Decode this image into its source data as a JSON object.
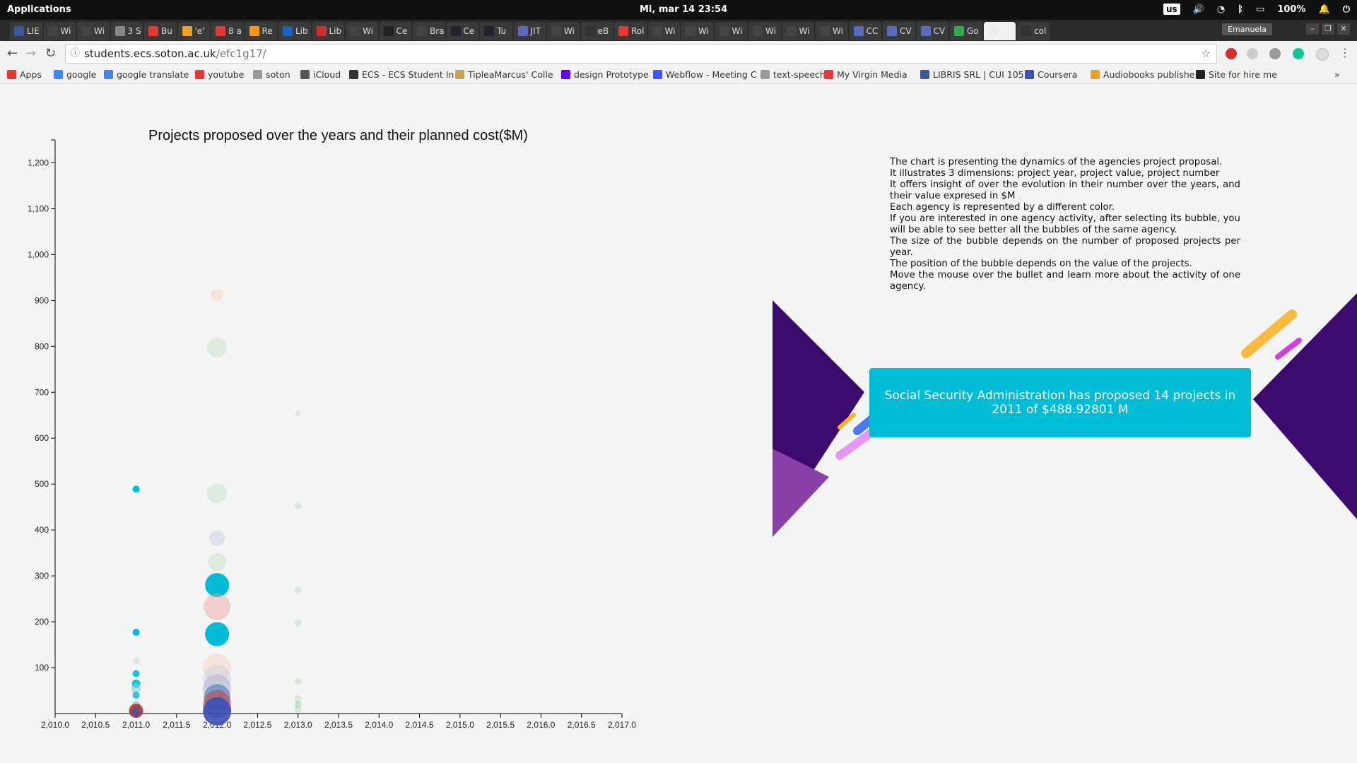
{
  "system_bar": {
    "apps_label": "Applications",
    "datetime": "Mi, mar 14    23:54",
    "keyboard": "us",
    "battery": "100%"
  },
  "browser": {
    "tabs": [
      "LIE",
      "Wi",
      "Wi",
      "3 S",
      "Bu",
      "'e'",
      "8 a",
      "Re",
      "Lib",
      "Lib",
      "Wi",
      "Ce",
      "Bra",
      "Ce",
      "Tu",
      "JIT",
      "Wi",
      "eB",
      "Rol",
      "Wi",
      "Wi",
      "Wi",
      "Wi",
      "Wi",
      "Wi",
      "CC",
      "CV",
      "CV",
      "Go",
      "",
      "col"
    ],
    "user": "Emanuela",
    "url_host": "students.ecs.soton.ac.uk",
    "url_path": "/efc1g17/",
    "bookmarks": [
      "Apps",
      "google",
      "google translate",
      "youtube",
      "soton",
      "iCloud",
      "ECS - ECS Student In",
      "TipleaMarcus' Colle",
      "design Prototype",
      "Webflow - Meeting C",
      "text-speech",
      "My Virgin Media",
      "LIBRIS SRL | CUI 105",
      "Coursera",
      "Audiobooks publishe",
      "Site for hire me"
    ]
  },
  "description": [
    "The chart is presenting the dynamics of the agencies project proposal.",
    "It illustrates 3 dimensions: project year, project value, project number",
    "It offers insight of over the evolution in their number over the years, and their value expresed in $M",
    "Each agency is represented by a different color.",
    "If you are interested in one agency activity, after selecting its bubble, you will be able to see better all the bubbles of the same agency.",
    "The size of the bubble depends on the number of proposed projects per year.",
    "The position of the bubble depends on the value of the projects.",
    "Move the mouse over the bullet and learn more about the activity of one agency."
  ],
  "tooltip": "Social Security Administration has proposed 14 projects in 2011 of $488.92801 M",
  "chart_data": {
    "type": "scatter",
    "title": "Projects proposed over the years and their planned cost($M)",
    "xlabel": "",
    "ylabel": "",
    "xlim": [
      2010.0,
      2017.0
    ],
    "ylim": [
      0,
      1250
    ],
    "x_ticks": [
      "2,010.0",
      "2,010.5",
      "2,011.0",
      "2,011.5",
      "2,012.0",
      "2,012.5",
      "2,013.0",
      "2,013.5",
      "2,014.0",
      "2,014.5",
      "2,015.0",
      "2,015.5",
      "2,016.0",
      "2,016.5",
      "2,017.0"
    ],
    "y_ticks": [
      "100",
      "200",
      "300",
      "400",
      "500",
      "600",
      "700",
      "800",
      "900",
      "1,000",
      "1,100",
      "1,200"
    ],
    "points": [
      {
        "x": 2011,
        "y": 489,
        "size": 5,
        "color": "#00bcd4",
        "opacity": 1
      },
      {
        "x": 2011,
        "y": 177,
        "size": 5,
        "color": "#00bcd4",
        "opacity": 1
      },
      {
        "x": 2011,
        "y": 115,
        "size": 5,
        "color": "#c8c8c8",
        "opacity": 0.4
      },
      {
        "x": 2011,
        "y": 87,
        "size": 5,
        "color": "#00bcd4",
        "opacity": 0.9
      },
      {
        "x": 2011,
        "y": 65,
        "size": 6,
        "color": "#00bcd4",
        "opacity": 0.9
      },
      {
        "x": 2011,
        "y": 55,
        "size": 7,
        "color": "#7fcfdc",
        "opacity": 0.6
      },
      {
        "x": 2011,
        "y": 40,
        "size": 5,
        "color": "#00bcd4",
        "opacity": 0.8
      },
      {
        "x": 2011,
        "y": 18,
        "size": 6,
        "color": "#9aa6c8",
        "opacity": 0.6
      },
      {
        "x": 2011,
        "y": 6,
        "size": 10,
        "color": "#b0302e",
        "opacity": 0.9
      },
      {
        "x": 2011,
        "y": 3,
        "size": 6,
        "color": "#3a55b0",
        "opacity": 0.8
      },
      {
        "x": 2012,
        "y": 912,
        "size": 9,
        "color": "#f5c8a8",
        "opacity": 0.35
      },
      {
        "x": 2012,
        "y": 797,
        "size": 14,
        "color": "#9ed4a8",
        "opacity": 0.3
      },
      {
        "x": 2012,
        "y": 480,
        "size": 14,
        "color": "#9ed4a8",
        "opacity": 0.3
      },
      {
        "x": 2012,
        "y": 382,
        "size": 11,
        "color": "#aab4dc",
        "opacity": 0.3
      },
      {
        "x": 2012,
        "y": 330,
        "size": 13,
        "color": "#9ed4a8",
        "opacity": 0.3
      },
      {
        "x": 2012,
        "y": 280,
        "size": 17,
        "color": "#00bcd4",
        "opacity": 1
      },
      {
        "x": 2012,
        "y": 233,
        "size": 19,
        "color": "#f0a0a0",
        "opacity": 0.45
      },
      {
        "x": 2012,
        "y": 173,
        "size": 17,
        "color": "#00bcd4",
        "opacity": 1
      },
      {
        "x": 2012,
        "y": 100,
        "size": 20,
        "color": "#f0c8b0",
        "opacity": 0.35
      },
      {
        "x": 2012,
        "y": 75,
        "size": 20,
        "color": "#c8c8e0",
        "opacity": 0.4
      },
      {
        "x": 2012,
        "y": 55,
        "size": 20,
        "color": "#a8a8d0",
        "opacity": 0.45
      },
      {
        "x": 2012,
        "y": 35,
        "size": 19,
        "color": "#4a7ab0",
        "opacity": 0.6
      },
      {
        "x": 2012,
        "y": 20,
        "size": 20,
        "color": "#c04040",
        "opacity": 0.55
      },
      {
        "x": 2012,
        "y": 5,
        "size": 20,
        "color": "#3a50b8",
        "opacity": 0.9
      },
      {
        "x": 2013,
        "y": 654,
        "size": 4,
        "color": "#9ed4a8",
        "opacity": 0.35
      },
      {
        "x": 2013,
        "y": 452,
        "size": 5,
        "color": "#9ed4a8",
        "opacity": 0.35
      },
      {
        "x": 2013,
        "y": 270,
        "size": 5,
        "color": "#9ed4a8",
        "opacity": 0.35
      },
      {
        "x": 2013,
        "y": 198,
        "size": 5,
        "color": "#9ed4a8",
        "opacity": 0.35
      },
      {
        "x": 2013,
        "y": 70,
        "size": 5,
        "color": "#9ed4a8",
        "opacity": 0.35
      },
      {
        "x": 2013,
        "y": 32,
        "size": 5,
        "color": "#9ed4a8",
        "opacity": 0.35
      },
      {
        "x": 2013,
        "y": 20,
        "size": 5,
        "color": "#7ab87a",
        "opacity": 0.35
      },
      {
        "x": 2013,
        "y": 8,
        "size": 5,
        "color": "#9ed4a8",
        "opacity": 0.35
      },
      {
        "x": 2014,
        "y": 236,
        "size": 1,
        "color": "#cccccc",
        "opacity": 0.4
      }
    ]
  }
}
